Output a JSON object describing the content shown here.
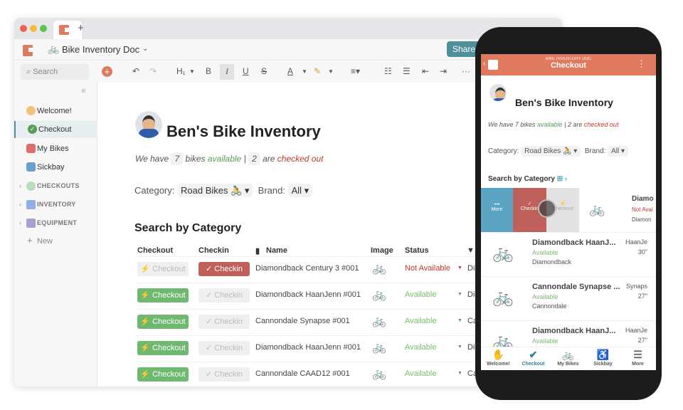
{
  "window": {
    "tab_icon": "coda-logo",
    "new_tab": "+"
  },
  "header": {
    "doc_title": "Bike Inventory Doc",
    "doc_icon": "bike-icon",
    "share": "Share"
  },
  "toolbar": {
    "search_placeholder": "Search",
    "items": [
      "undo",
      "redo",
      "H1",
      "B",
      "I",
      "U",
      "S",
      "A",
      "highlight",
      "align",
      "bullets",
      "numbered",
      "outdent",
      "indent",
      "more"
    ],
    "h1": "H₁",
    "bold": "B",
    "italic": "I",
    "underline": "U",
    "strike": "S",
    "font_color": "A",
    "more": "···"
  },
  "sidebar": {
    "collapse": "«",
    "items": [
      {
        "label": "Welcome!",
        "icon": "wave-icon"
      },
      {
        "label": "Checkout",
        "icon": "check-circle-icon",
        "active": true
      },
      {
        "label": "My Bikes",
        "icon": "bike-icon"
      },
      {
        "label": "Sickbay",
        "icon": "mechanic-icon"
      }
    ],
    "sections": [
      {
        "label": "CHECKOUTS"
      },
      {
        "label": "INVENTORY"
      },
      {
        "label": "EQUIPMENT"
      }
    ],
    "new": "New"
  },
  "doc": {
    "title": "Ben's Bike Inventory",
    "sub": {
      "a": "We have",
      "n1": "7",
      "b": "bikes",
      "avail": "available",
      "sep": "|",
      "n2": "2",
      "c": "are",
      "out": "checked out"
    },
    "category_label": "Category:",
    "category_value": "Road Bikes 🚴",
    "brand_label": "Brand:",
    "brand_value": "All",
    "section_title": "Search by Category",
    "columns": [
      "Checkout",
      "Checkin",
      "Name",
      "Image",
      "Status"
    ],
    "rows": [
      {
        "checkout": "Checkout",
        "checkin": "Checkin",
        "name": "Diamondback Century 3 #001",
        "status": "Not Available",
        "extra": "Dia",
        "available": false
      },
      {
        "checkout": "Checkout",
        "checkin": "Checkin",
        "name": "Diamondback HaanJenn #001",
        "status": "Available",
        "extra": "Dia",
        "available": true
      },
      {
        "checkout": "Checkout",
        "checkin": "Checkin",
        "name": "Cannondale Synapse #001",
        "status": "Available",
        "extra": "Ca",
        "available": true
      },
      {
        "checkout": "Checkout",
        "checkin": "Checkin",
        "name": "Diamondback HaanJenn #001",
        "status": "Available",
        "extra": "Dia",
        "available": true
      },
      {
        "checkout": "Checkout",
        "checkin": "Checkin",
        "name": "Cannondale CAAD12 #001",
        "status": "Available",
        "extra": "Ca",
        "available": true
      }
    ]
  },
  "phone": {
    "doc_label": "BIKE INVENTORY DOC",
    "page": "Checkout",
    "title": "Ben's Bike Inventory",
    "swipe": {
      "more": "More",
      "checkin": "Checkin",
      "checkout": "Checkout"
    },
    "rows": [
      {
        "name": "Diamo",
        "status": "Not Avai",
        "brand": "Diamon"
      },
      {
        "name": "Diamondback HaanJ...",
        "status": "Available",
        "brand": "Diamondback",
        "r1": "HaanJe",
        "r2": "30\""
      },
      {
        "name": "Cannondale Synapse ...",
        "status": "Available",
        "brand": "Cannondale",
        "r1": "Synaps",
        "r2": "27\""
      },
      {
        "name": "Diamondback HaanJ...",
        "status": "Available",
        "brand": "",
        "r1": "HaanJe",
        "r2": "27\""
      }
    ],
    "nav": [
      {
        "label": "Welcome!",
        "icon": "wave-icon"
      },
      {
        "label": "Checkout",
        "icon": "check-circle-icon"
      },
      {
        "label": "My Bikes",
        "icon": "bike-icon"
      },
      {
        "label": "Sickbay",
        "icon": "mechanic-icon"
      },
      {
        "label": "More",
        "icon": "menu-icon"
      }
    ]
  },
  "colors": {
    "brand": "#e07a5f",
    "share": "#4f8f9c",
    "available": "#5a9b5a",
    "not_available": "#c0392b",
    "checkout_btn": "#6fb86f",
    "checkin_btn": "#c0605a",
    "more_swipe": "#5ba4c4"
  }
}
